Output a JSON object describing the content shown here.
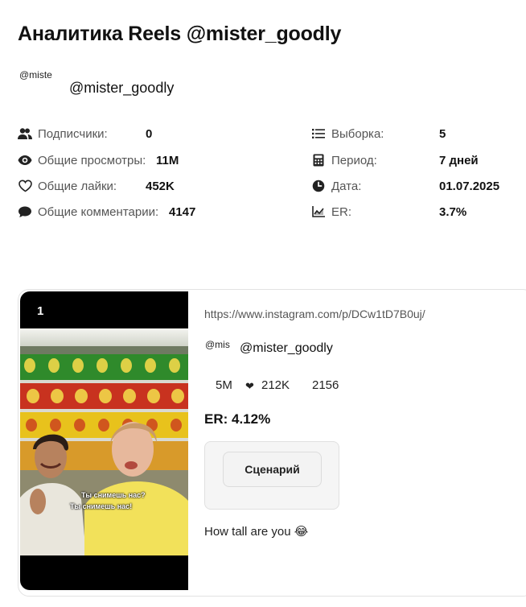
{
  "page": {
    "title": "Аналитика Reels @mister_goodly"
  },
  "profile": {
    "avatar_alt": "@miste",
    "handle": "@mister_goodly"
  },
  "stats_left": [
    {
      "icon": "users-icon",
      "label": "Подписчики:",
      "value": "0"
    },
    {
      "icon": "eye-icon",
      "label": "Общие просмотры:",
      "value": "11M"
    },
    {
      "icon": "heart-icon",
      "label": "Общие лайки:",
      "value": "452K"
    },
    {
      "icon": "comment-icon",
      "label": "Общие комментарии:",
      "value": "4147"
    }
  ],
  "stats_right": [
    {
      "icon": "list-icon",
      "label": "Выборка:",
      "value": "5"
    },
    {
      "icon": "calculator-icon",
      "label": "Период:",
      "value": "7 дней"
    },
    {
      "icon": "clock-icon",
      "label": "Дата:",
      "value": "01.07.2025"
    },
    {
      "icon": "chart-icon",
      "label": "ER:",
      "value": "3.7%"
    }
  ],
  "post": {
    "rank": "1",
    "url": "https://www.instagram.com/p/DCw1tD7B0uj/",
    "avatar_alt": "@mis",
    "handle": "@mister_goodly",
    "views": "5M",
    "likes": "212K",
    "likes_icon": "❤",
    "comments": "2156",
    "er": "ER: 4.12%",
    "script_button": "Сценарий",
    "description": "How tall are you 😂",
    "caption_line1": "Ты снимешь нас?",
    "caption_line2": "Ты снимешь нас!",
    "colors": {
      "shelf_yellow": "#e8c21c",
      "shelf_green": "#2f8a2b",
      "shelf_red": "#c8321f",
      "shirt_yellow": "#f2e15a"
    }
  }
}
